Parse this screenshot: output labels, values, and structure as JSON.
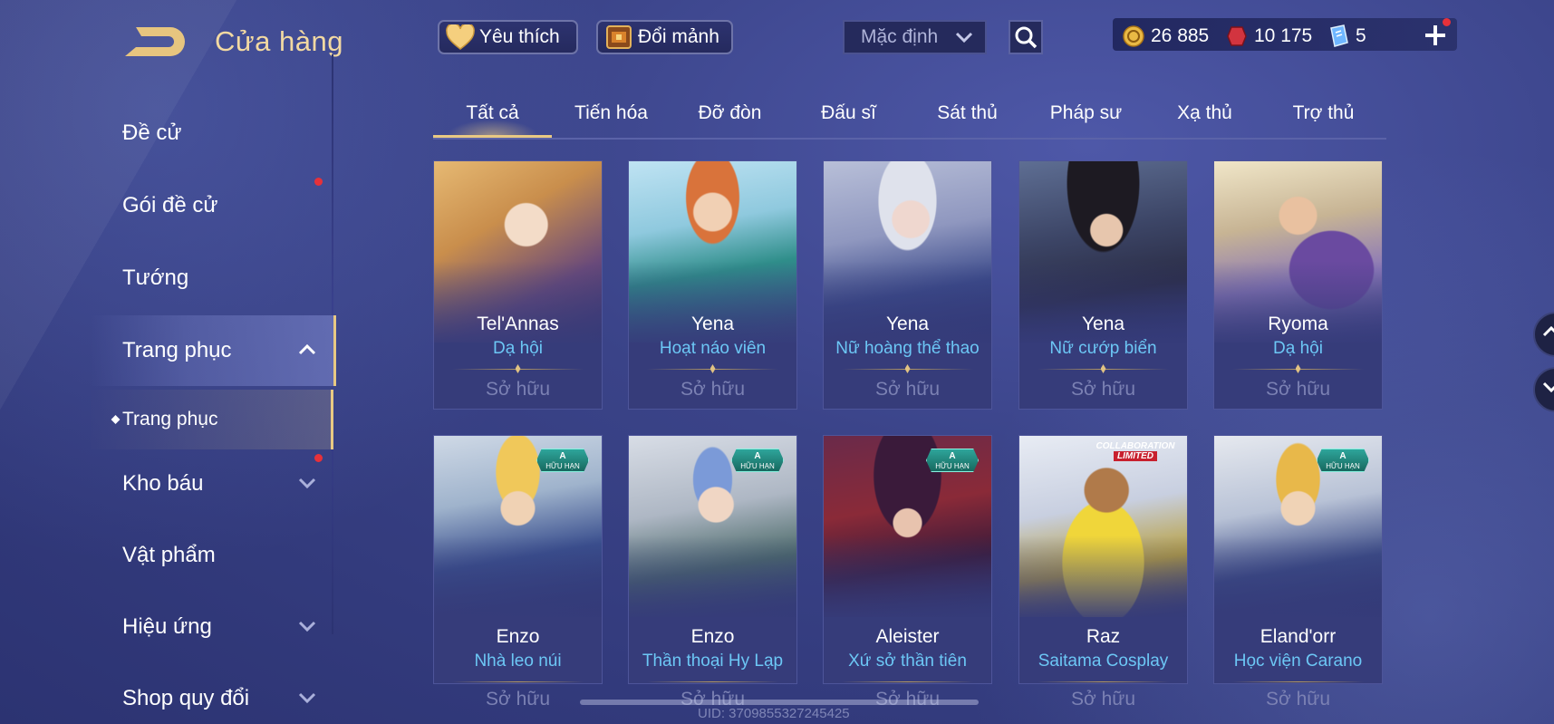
{
  "header": {
    "title": "Cửa hàng",
    "favorites_label": "Yêu thích",
    "exchange_label": "Đổi mảnh",
    "sort_value": "Mặc định"
  },
  "currencies": {
    "gold": "26 885",
    "vouchers": "10 175",
    "tickets": "5"
  },
  "sidebar": {
    "items": [
      {
        "label": "Đề cử"
      },
      {
        "label": "Gói đề cử"
      },
      {
        "label": "Tướng"
      },
      {
        "label": "Trang phục"
      },
      {
        "label": "Kho báu"
      },
      {
        "label": "Vật phẩm"
      },
      {
        "label": "Hiệu ứng"
      },
      {
        "label": "Shop quy đổi"
      }
    ],
    "sub_item": "Trang phục"
  },
  "tabs": [
    "Tất cả",
    "Tiến hóa",
    "Đỡ đòn",
    "Đấu sĩ",
    "Sát thủ",
    "Pháp sư",
    "Xạ thủ",
    "Trợ thủ"
  ],
  "cards": [
    {
      "hero": "Tel'Annas",
      "skin": "Dạ hội",
      "status": "Sở hữu"
    },
    {
      "hero": "Yena",
      "skin": "Hoạt náo viên",
      "status": "Sở hữu"
    },
    {
      "hero": "Yena",
      "skin": "Nữ hoàng thể thao",
      "status": "Sở hữu"
    },
    {
      "hero": "Yena",
      "skin": "Nữ cướp biển",
      "status": "Sở hữu"
    },
    {
      "hero": "Ryoma",
      "skin": "Dạ hội",
      "status": "Sở hữu"
    },
    {
      "hero": "Enzo",
      "skin": "Nhà leo núi",
      "status": "Sở hữu",
      "badge_tier": "A",
      "badge_text": "HỮU HẠN"
    },
    {
      "hero": "Enzo",
      "skin": "Thần thoại Hy Lạp",
      "status": "Sở hữu",
      "badge_tier": "A",
      "badge_text": "HỮU HẠN"
    },
    {
      "hero": "Aleister",
      "skin": "Xứ sở thần tiên",
      "status": "Sở hữu",
      "badge_tier": "A",
      "badge_text": "HỮU HẠN"
    },
    {
      "hero": "Raz",
      "skin": "Saitama Cosplay",
      "status": "Sở hữu",
      "collab_line1": "COLLABORATION",
      "collab_line2": "LIMITED"
    },
    {
      "hero": "Eland'orr",
      "skin": "Học viện Carano",
      "status": "Sở hữu",
      "badge_tier": "A",
      "badge_text": "HỮU HẠN"
    }
  ],
  "footer": {
    "uid": "UID: 3709855327245425"
  },
  "colors": {
    "accent_gold": "#e8c983",
    "skin_name": "#6cc7f5",
    "background": "#3a4388"
  }
}
